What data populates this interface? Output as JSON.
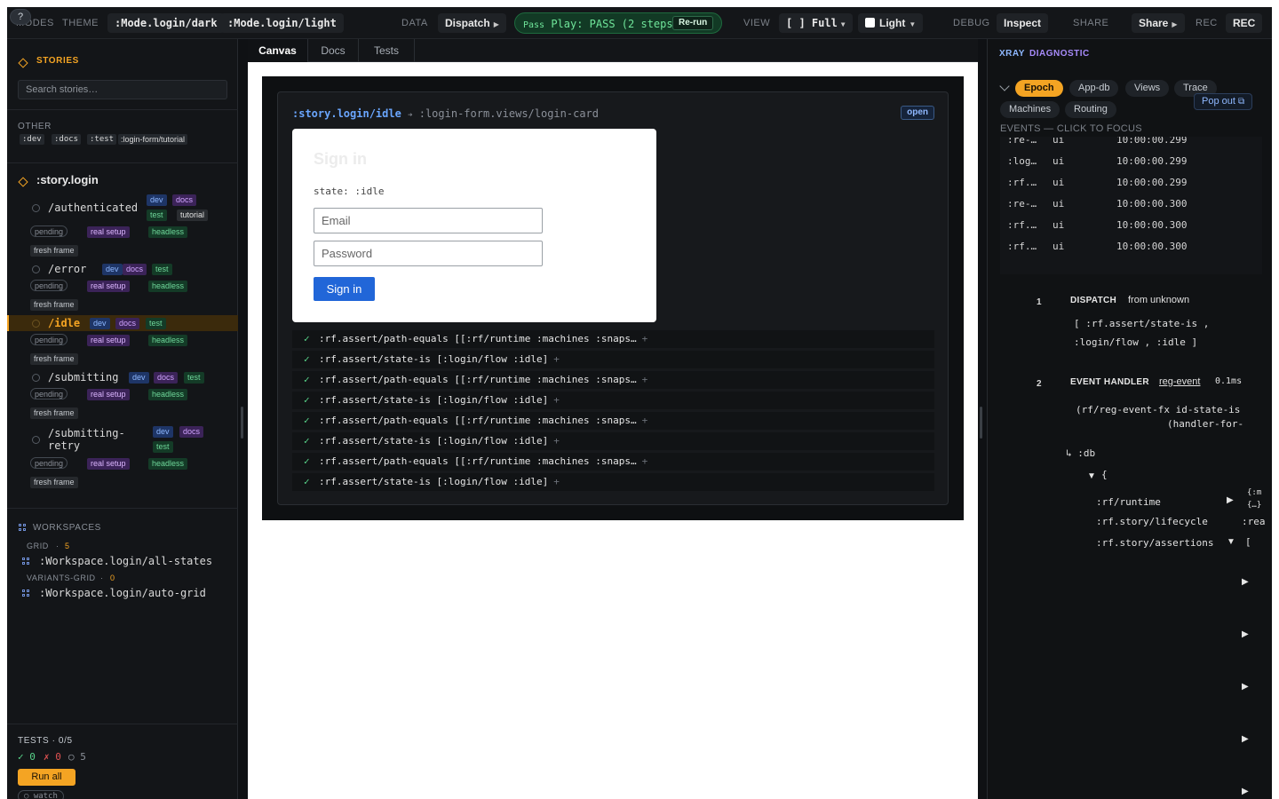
{
  "topbar": {
    "help": "?",
    "modes_label": "MODES",
    "theme_label": "THEME",
    "mode_dark": ":Mode.login/dark",
    "mode_light": ":Mode.login/light",
    "data_label": "DATA",
    "dispatch": "Dispatch",
    "pass_text": "Pass Play: PASS (2 steps)",
    "pass_small": "Pass",
    "pass_main": " Play: PASS (2 steps)",
    "rerun": "Re-run",
    "view_label": "VIEW",
    "full": "[ ] Full",
    "light": "Light",
    "debug_label": "DEBUG",
    "inspect": "Inspect",
    "share_label": "SHARE",
    "share": "Share",
    "rec_label": "REC",
    "rec": "REC",
    "colors": {
      "accent": "#f4a423",
      "pass": "#6fe59a",
      "link": "#8fb8ff"
    }
  },
  "sidebar": {
    "stories_title": "STORIES",
    "search_placeholder": "Search stories…",
    "other_title": "OTHER",
    "other_tags": [
      ":dev",
      ":docs",
      ":test",
      ":login-form/tutorial"
    ],
    "group_title": ":story.login",
    "stories": [
      {
        "name": "/authenticated",
        "tags": [
          "dev",
          "docs",
          "test",
          "tutorial"
        ],
        "status": "pending",
        "setup": "real setup",
        "mode": "headless",
        "frame": "fresh frame"
      },
      {
        "name": "/error",
        "tags": [
          "dev",
          "docs",
          "test"
        ],
        "status": "pending",
        "setup": "real setup",
        "mode": "headless",
        "frame": "fresh frame"
      },
      {
        "name": "/idle",
        "tags": [
          "dev",
          "docs",
          "test"
        ],
        "status": "pending",
        "setup": "real setup",
        "mode": "headless",
        "frame": "fresh frame"
      },
      {
        "name": "/submitting",
        "tags": [
          "dev",
          "docs",
          "test"
        ],
        "status": "pending",
        "setup": "real setup",
        "mode": "headless",
        "frame": "fresh frame"
      },
      {
        "name_line1": "/submitting-",
        "name_line2": "retry",
        "tags": [
          "dev",
          "docs",
          "test"
        ],
        "status": "pending",
        "setup": "real setup",
        "mode": "headless",
        "frame": "fresh frame"
      }
    ],
    "workspaces_title": "WORKSPACES",
    "grid_label": "GRID",
    "grid_count": "5",
    "grid_item": ":Workspace.login/all-states",
    "variants_label": "VARIANTS-GRID",
    "variants_count": "0",
    "variants_item": ":Workspace.login/auto-grid",
    "tests_title": "TESTS · 0/5",
    "tests_pass": "✓ 0",
    "tests_fail": "✗ 0",
    "tests_pending": "○ 5",
    "run_all": "Run all",
    "watch": "○ watch"
  },
  "center": {
    "tabs": [
      "Canvas",
      "Docs",
      "Tests"
    ],
    "story_id": ":story.login/idle",
    "arrow": "➔",
    "view_id": ":login-form.views/login-card",
    "open": "open",
    "login": {
      "title": "Sign in",
      "state": "state: :idle",
      "email_placeholder": "Email",
      "password_placeholder": "Password",
      "submit": "Sign in"
    },
    "assertions": [
      ":rf.assert/path-equals [[:rf/runtime :machines :snaps…",
      ":rf.assert/state-is [:login/flow :idle]",
      ":rf.assert/path-equals [[:rf/runtime :machines :snaps…",
      ":rf.assert/state-is [:login/flow :idle]",
      ":rf.assert/path-equals [[:rf/runtime :machines :snaps…",
      ":rf.assert/state-is [:login/flow :idle]",
      ":rf.assert/path-equals [[:rf/runtime :machines :snaps…",
      ":rf.assert/state-is [:login/flow :idle]"
    ],
    "check": "✓",
    "plus": "+"
  },
  "right": {
    "xray": "XRAY",
    "diagnostic": "DIAGNOSTIC",
    "tabs": [
      "Epoch",
      "App-db",
      "Views",
      "Trace",
      "Machines",
      "Routing"
    ],
    "popout": "Pop out",
    "events_title": "EVENTS — CLICK TO FOCUS",
    "events": [
      {
        "name": ":re-…",
        "src": "ui",
        "time": "10:00:00.299"
      },
      {
        "name": ":log…",
        "src": "ui",
        "time": "10:00:00.299"
      },
      {
        "name": ":rf.…",
        "src": "ui",
        "time": "10:00:00.299"
      },
      {
        "name": ":re-…",
        "src": "ui",
        "time": "10:00:00.300"
      },
      {
        "name": ":rf.…",
        "src": "ui",
        "time": "10:00:00.300"
      },
      {
        "name": ":rf.…",
        "src": "ui",
        "time": "10:00:00.300"
      }
    ],
    "trace": {
      "n1": "1",
      "dispatch": "DISPATCH",
      "from": "from unknown",
      "vec1": "[ :rf.assert/state-is ,",
      "vec2": ":login/flow , :idle ]",
      "n2": "2",
      "handler": "EVENT HANDLER",
      "handler_name": "reg-event",
      "duration": "0.1ms",
      "code1": "(rf/reg-event-fx id-state-is",
      "code2": "(handler-for-e",
      "db": "↳ :db",
      "brace": "{",
      "keys": [
        ":rf/runtime",
        ":rf.story/lifecycle",
        ":rf.story/assertions"
      ],
      "val1a": "{:m",
      "val1b": "{…}",
      "val2": ":rea",
      "val3": "["
    }
  }
}
